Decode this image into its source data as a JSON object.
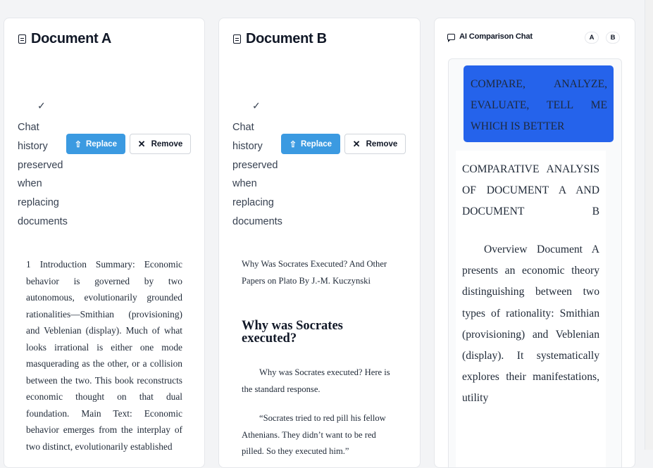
{
  "documents": [
    {
      "title": "Document A",
      "check": "✓",
      "status_words": [
        "Chat",
        "history",
        "preserved",
        "when",
        "replacing",
        "documents"
      ],
      "replace_label": "Replace",
      "remove_label": "Remove",
      "content": "1 Introduction Summary: Economic behavior is governed by two autonomous, evolutionarily grounded rationalities—Smithian (provisioning) and Veblenian (display). Much of what looks irrational is either one mode masquerading as the other, or a collision between the two. This book reconstructs economic thought on that dual foundation. Main Text: Economic behavior emerges from the interplay of two distinct, evolutionarily established"
    },
    {
      "title": "Document B",
      "check": "✓",
      "status_words": [
        "Chat",
        "history",
        "preserved",
        "when",
        "replacing",
        "documents"
      ],
      "replace_label": "Replace",
      "remove_label": "Remove",
      "header_text": "Why Was Socrates Executed? And Other Papers on Plato By J.-M. Kuczynski",
      "heading": "Why was Socrates executed?",
      "para1": "Why was Socrates executed? Here is the standard response.",
      "para2": "“Socrates tried to red pill his fellow Athenians. They didn’t want to be red pilled. So they executed him.”"
    }
  ],
  "chat": {
    "title": "AI Comparison Chat",
    "badge_a": "A",
    "badge_b": "B",
    "user_message": "COMPARE, ANALYZE, EVALUATE, TELL ME WHICH IS BETTER",
    "ai_title": "COMPARATIVE ANALYSIS OF DOCUMENT A AND DOCUMENT B",
    "ai_body": "Overview Document A presents an economic theory distinguishing between two types of rationality: Smithian (provisioning) and Veblenian (display). It systematically explores their manifestations, utility"
  },
  "colors": {
    "primary_button": "#3b9ae1",
    "user_bubble": "#2563eb"
  }
}
